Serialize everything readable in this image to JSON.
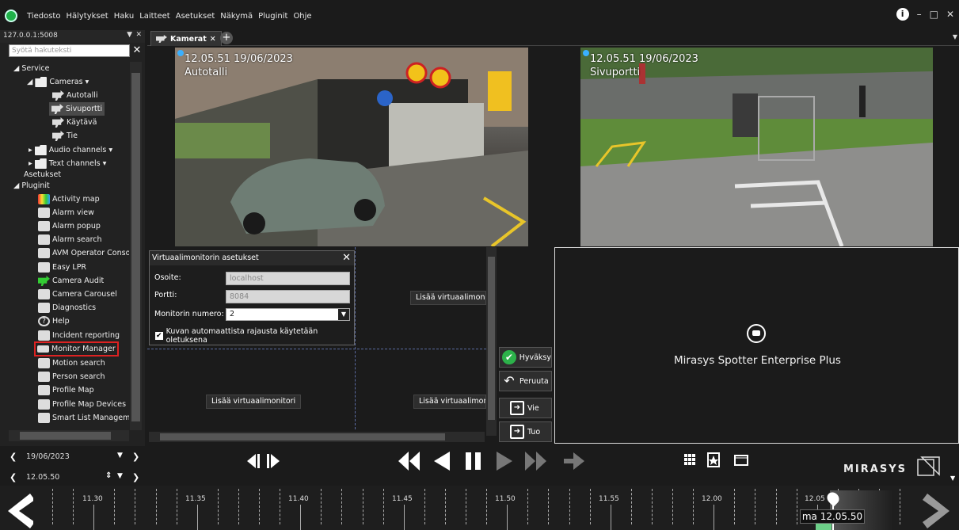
{
  "menubar": {
    "items": [
      "Tiedosto",
      "Hälytykset",
      "Haku",
      "Laitteet",
      "Asetukset",
      "Näkymä",
      "Pluginit",
      "Ohje"
    ]
  },
  "left_panel": {
    "server": "127.0.0.1:5008",
    "search_placeholder": "Syötä hakuteksti",
    "tree": {
      "service": "Service",
      "cameras": "Cameras",
      "cameras_list": [
        "Autotalli",
        "Sivuportti",
        "Käytävä",
        "Tie"
      ],
      "selected_camera": "Sivuportti",
      "audio": "Audio channels",
      "text": "Text channels",
      "asetukset": "Asetukset",
      "pluginit": "Pluginit",
      "plugins": [
        "Activity map",
        "Alarm view",
        "Alarm popup",
        "Alarm search",
        "AVM Operator Conso",
        "Easy LPR",
        "Camera Audit",
        "Camera Carousel",
        "Diagnostics",
        "Help",
        "Incident reporting",
        "Monitor Manager",
        "Motion search",
        "Person search",
        "Profile Map",
        "Profile Map Devices",
        "Smart List Managem"
      ],
      "highlighted_plugin": "Monitor Manager"
    }
  },
  "tabs": {
    "active": "Kamerat",
    "close": "✕",
    "add": "+"
  },
  "cameras": {
    "cam1": {
      "timestamp": "12.05.51  19/06/2023",
      "name": "Autotalli"
    },
    "cam2": {
      "timestamp": "12.05.51  19/06/2023",
      "name": "Sivuportti"
    }
  },
  "dialog": {
    "title": "Virtuaalimonitorin asetukset",
    "address_label": "Osoite:",
    "address_value": "localhost",
    "port_label": "Portti:",
    "port_value": "8084",
    "monitor_label": "Monitorin numero:",
    "monitor_value": "2",
    "checkbox_label": "Kuvan automaattista rajausta käytetään oletuksena",
    "checkbox_checked": true
  },
  "grid": {
    "add_label": "Lisää virtuaalimonitori",
    "add_label_cut": "Lisää virtuaalimoni"
  },
  "actions": {
    "accept": "Hyväksy",
    "cancel": "Peruuta",
    "export": "Vie",
    "import": "Tuo"
  },
  "brand_panel": {
    "text": "Mirasys Spotter Enterprise Plus"
  },
  "controls": {
    "date": "19/06/2023",
    "time": "12.05.50",
    "logo": "MIRASYS"
  },
  "timeline": {
    "labels": [
      "11.30",
      "11.35",
      "11.40",
      "11.45",
      "11.50",
      "11.55",
      "12.00",
      "12.05"
    ],
    "cursor": "ma 12.05.50"
  },
  "colors": {
    "background": "#1b1b1b",
    "accent_green": "#1fb24a",
    "highlight_red": "#d22222",
    "grid_dash": "#5a6aa0"
  }
}
